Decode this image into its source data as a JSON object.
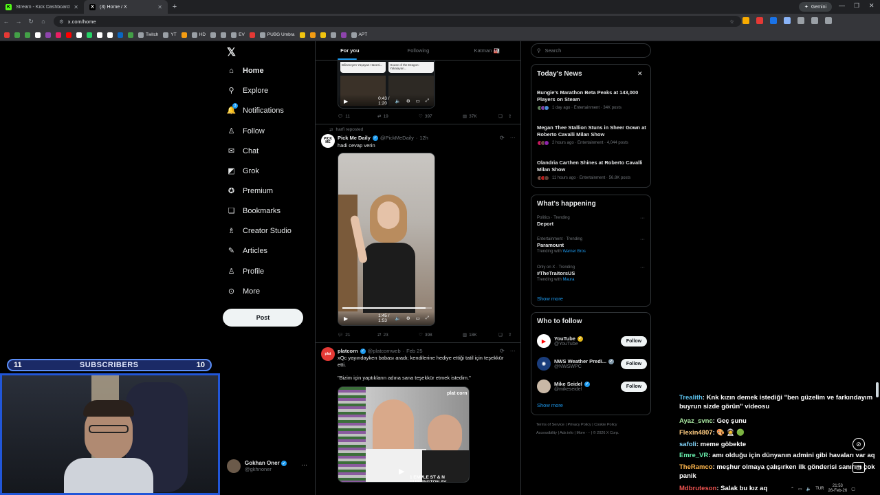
{
  "browser": {
    "tabs": [
      {
        "title": "Stream - Kick Dashboard",
        "favicon": "K"
      },
      {
        "title": "(3) Home / X",
        "favicon": "X"
      }
    ],
    "gemini_label": "Gemini",
    "url": "x.com/home",
    "bookmarks": [
      {
        "label": "",
        "color": "#e53935"
      },
      {
        "label": "",
        "color": "#43a047"
      },
      {
        "label": "",
        "color": "#43a047"
      },
      {
        "label": "",
        "color": "#ffffff"
      },
      {
        "label": "",
        "color": "#8e44ad"
      },
      {
        "label": "",
        "color": "#e91e63"
      },
      {
        "label": "",
        "color": "#ff0000"
      },
      {
        "label": "",
        "color": "#ffffff"
      },
      {
        "label": "",
        "color": "#25d366"
      },
      {
        "label": "",
        "color": "#ffffff"
      },
      {
        "label": "",
        "color": "#ffffff"
      },
      {
        "label": "",
        "color": "#0a66c2"
      },
      {
        "label": "",
        "color": "#43a047"
      },
      {
        "label": "Twitch",
        "color": "#9aa0a6"
      },
      {
        "label": "YT",
        "color": "#9aa0a6"
      },
      {
        "label": "",
        "color": "#f39c12"
      },
      {
        "label": "HD",
        "color": "#9aa0a6"
      },
      {
        "label": "",
        "color": "#9aa0a6"
      },
      {
        "label": "",
        "color": "#9aa0a6"
      },
      {
        "label": "EV",
        "color": "#9aa0a6"
      },
      {
        "label": "",
        "color": "#e53935"
      },
      {
        "label": "PUBG Umbra",
        "color": "#9aa0a6"
      },
      {
        "label": "",
        "color": "#f1c40f"
      },
      {
        "label": "",
        "color": "#f39c12"
      },
      {
        "label": "",
        "color": "#f1c40f"
      },
      {
        "label": "",
        "color": "#9aa0a6"
      },
      {
        "label": "",
        "color": "#8e44ad"
      },
      {
        "label": "APT",
        "color": "#9aa0a6"
      }
    ]
  },
  "x": {
    "nav": [
      {
        "label": "Home",
        "icon": "home-icon",
        "glyph": "⌂"
      },
      {
        "label": "Explore",
        "icon": "search-icon",
        "glyph": "⚲"
      },
      {
        "label": "Notifications",
        "icon": "bell-icon",
        "glyph": "🔔"
      },
      {
        "label": "Follow",
        "icon": "person-plus-icon",
        "glyph": "♙"
      },
      {
        "label": "Chat",
        "icon": "mail-icon",
        "glyph": "✉"
      },
      {
        "label": "Grok",
        "icon": "grok-icon",
        "glyph": "◩"
      },
      {
        "label": "Premium",
        "icon": "premium-icon",
        "glyph": "✪"
      },
      {
        "label": "Bookmarks",
        "icon": "bookmark-icon",
        "glyph": "❏"
      },
      {
        "label": "Creator Studio",
        "icon": "creator-icon",
        "glyph": "♗"
      },
      {
        "label": "Articles",
        "icon": "articles-icon",
        "glyph": "✎"
      },
      {
        "label": "Profile",
        "icon": "profile-icon",
        "glyph": "♙"
      },
      {
        "label": "More",
        "icon": "more-circle-icon",
        "glyph": "⊙"
      }
    ],
    "notifications_badge": "3",
    "post_button": "Post",
    "account": {
      "name": "Gokhan Oner",
      "handle": "@gkhnoner"
    },
    "feed_tabs": [
      "For you",
      "Following",
      "Katman 🏭"
    ],
    "post1": {
      "time": "0:43 / 1:20",
      "replies": "11",
      "reposts": "19",
      "likes": "397",
      "views": "37K",
      "captions": [
        "Bilinmeyen Yaşayan Hanesi...",
        "House of the Dragon: Yakalayan..."
      ]
    },
    "post2": {
      "repost_label": "harfi reposted",
      "name": "Pick Me Daily",
      "handle": "@PickMeDaily",
      "age": "12h",
      "text": "hadi cevap verin",
      "video_time": "1:45 / 1:53",
      "video_progress": 0.93,
      "replies": "21",
      "reposts": "23",
      "likes": "398",
      "views": "18K"
    },
    "post3": {
      "name": "platcorn",
      "handle": "@platcornweb",
      "age": "Feb 25",
      "text": "xQc yayındayken babası aradı; kendilerine hediye ettiği tatil için teşekkür etti.",
      "quote": "\"Bizim için yaptıkların adına sana teşekkür etmek istedim.\"",
      "overlay_text": "1 EMPLE ST & N BURLINGTON AV"
    },
    "search_placeholder": "Search",
    "todays_news": {
      "title": "Today's News",
      "items": [
        {
          "title": "Bungie's Marathon Beta Peaks at 143,000 Players on Steam",
          "meta": "1 day ago · Entertainment · 34K posts"
        },
        {
          "title": "Megan Thee Stallion Stuns in Sheer Gown at Roberto Cavalli Milan Show",
          "meta": "2 hours ago · Entertainment · 4,044 posts"
        },
        {
          "title": "Olandria Carthen Shines at Roberto Cavalli Milan Show",
          "meta": "11 hours ago · Entertainment · 56.8K posts"
        }
      ]
    },
    "whats_happening": {
      "title": "What's happening",
      "trends": [
        {
          "category": "Politics · Trending",
          "name": "Deport",
          "sub_prefix": "",
          "sub_link": ""
        },
        {
          "category": "Entertainment · Trending",
          "name": "Paramount",
          "sub_prefix": "Trending with",
          "sub_link": "Warner Bros"
        },
        {
          "category": "Only on X · Trending",
          "name": "#TheTraitorsUS",
          "sub_prefix": "Trending with",
          "sub_link": "Maura"
        }
      ],
      "show_more": "Show more"
    },
    "who_to_follow": {
      "title": "Who to follow",
      "accounts": [
        {
          "name": "YouTube",
          "handle": "@YouTube",
          "badge": "gold"
        },
        {
          "name": "NWS Weather Predi...",
          "handle": "@NWSWPC",
          "badge": "gray"
        },
        {
          "name": "Mike Seidel",
          "handle": "@mikeseidel",
          "badge": "blue"
        }
      ],
      "follow_label": "Follow",
      "show_more": "Show more"
    },
    "footer": [
      "Terms of Service",
      "Privacy Policy",
      "Cookie Policy",
      "Accessibility",
      "Ads info",
      "More ···",
      "© 2026 X Corp."
    ]
  },
  "stream": {
    "sub_left": "11",
    "sub_label": "SUBSCRIBERS",
    "sub_right": "10",
    "chat": [
      {
        "user": "Trealith",
        "color": "#5bc0eb",
        "text": ": Knk kızın demek istediği \"ben güzelim ve farkındayım buyrun sizde görün\" videosu"
      },
      {
        "user": "Ayaz_svnc",
        "color": "#a8e6a1",
        "text": ": Geç şunu"
      },
      {
        "user": "Flexin4807",
        "color": "#ffcc80",
        "text": ": 🎨 🧑‍🚀 🟢"
      },
      {
        "user": "safoli",
        "color": "#81d4fa",
        "text": ": meme göbekte"
      },
      {
        "user": "Emre_VR",
        "color": "#69f0ae",
        "text": ": amı olduğu için dünyanın admini gibi havaları var aq"
      },
      {
        "user": "TheRamco",
        "color": "#ffb74d",
        "text": ": meşhur olmaya çalışırken ilk gönderisi sanırım çok panik"
      },
      {
        "user": "Mdbruteson",
        "color": "#ef5350",
        "text": ": Salak bu kız aq"
      }
    ]
  },
  "system": {
    "lang": "TUR",
    "time": "21:53",
    "date": "26-Feb-26"
  }
}
